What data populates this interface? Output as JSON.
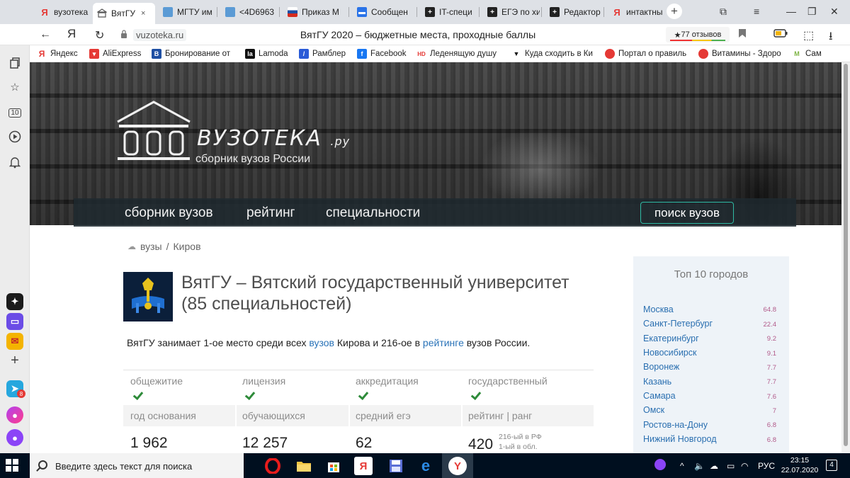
{
  "browser": {
    "tabs": [
      {
        "label": "вузотека",
        "icon": "yandex-icon"
      },
      {
        "label": "ВятГУ",
        "icon": "vuzoteka-favicon",
        "close": "×",
        "active": true
      },
      {
        "label": "МГТУ им",
        "icon": "site-favicon"
      },
      {
        "label": "<4D6963",
        "icon": "site-favicon"
      },
      {
        "label": "Приказ М",
        "icon": "flag-icon"
      },
      {
        "label": "Сообщен",
        "icon": "message-icon"
      },
      {
        "label": "IT-специ",
        "icon": "plus-icon"
      },
      {
        "label": "ЕГЭ по хи",
        "icon": "plus-icon"
      },
      {
        "label": "Редактор",
        "icon": "plus-icon"
      },
      {
        "label": "интактны",
        "icon": "yandex-icon"
      }
    ],
    "new_tab": "+",
    "url": "vuzoteka.ru",
    "page_title": "ВятГУ 2020 – бюджетные места, проходные баллы",
    "reviews": "77 отзывов",
    "reviews_star": "★",
    "bookmarks": [
      {
        "label": "Яндекс",
        "color": "#e53935",
        "glyph": "Я"
      },
      {
        "label": "AliExpress",
        "color": "#e53935",
        "glyph": "A"
      },
      {
        "label": "Бронирование от",
        "color": "#1e4fa3",
        "glyph": "B"
      },
      {
        "label": "Lamoda",
        "color": "#111111",
        "glyph": "la"
      },
      {
        "label": "Рамблер",
        "color": "#2a5bd7",
        "glyph": "/"
      },
      {
        "label": "Facebook",
        "color": "#1877f2",
        "glyph": "f"
      },
      {
        "label": "Леденящую душу",
        "color": "#e53935",
        "glyph": "HD"
      },
      {
        "label": "Куда сходить в Ки",
        "color": "#111111",
        "glyph": "▼"
      },
      {
        "label": "Портал о правиль",
        "color": "#e53935",
        "glyph": "●"
      },
      {
        "label": "Витамины - Здоро",
        "color": "#e53935",
        "glyph": "●"
      },
      {
        "label": "Сам",
        "color": "#7cb342",
        "glyph": "M"
      }
    ],
    "sidebar_counter": "10",
    "messenger_badge": "8"
  },
  "hero": {
    "site_name": "ВУЗОТЕКА",
    "site_suffix": ".ру",
    "slogan": "сборник вузов России"
  },
  "nav": {
    "items": [
      "сборник вузов",
      "рейтинг",
      "специальности"
    ],
    "search": "поиск вузов"
  },
  "breadcrumb": {
    "root": "вузы",
    "sep": "/",
    "city": "Киров"
  },
  "university": {
    "title": "ВятГУ – Вятский государственный университет (85 специальностей)",
    "desc_prefix": "ВятГУ занимает 1-ое место среди всех ",
    "desc_link1": "вузов",
    "desc_middle": " Кирова и 216-ое в ",
    "desc_link2": "рейтинге",
    "desc_suffix": " вузов России."
  },
  "stats": {
    "flags": [
      "общежитие",
      "лицензия",
      "аккредитация",
      "государственный"
    ],
    "headers": [
      "год основания",
      "обучающихся",
      "средний егэ",
      "рейтинг | ранг"
    ],
    "values": [
      "1 962",
      "12 257",
      "62",
      "420"
    ],
    "rank_rf": "216-ый в РФ",
    "rank_region": "1-ый в обл."
  },
  "top10": {
    "title": "Топ 10 городов",
    "cities": [
      {
        "name": "Москва",
        "score": "64.8"
      },
      {
        "name": "Санкт-Петербург",
        "score": "22.4"
      },
      {
        "name": "Екатеринбург",
        "score": "9.2"
      },
      {
        "name": "Новосибирск",
        "score": "9.1"
      },
      {
        "name": "Воронеж",
        "score": "7.7"
      },
      {
        "name": "Казань",
        "score": "7.7"
      },
      {
        "name": "Самара",
        "score": "7.6"
      },
      {
        "name": "Омск",
        "score": "7"
      },
      {
        "name": "Ростов-на-Дону",
        "score": "6.8"
      },
      {
        "name": "Нижний Новгород",
        "score": "6.8"
      }
    ]
  },
  "taskbar": {
    "search_placeholder": "Введите здесь текст для поиска",
    "lang": "РУС",
    "time": "23:15",
    "date": "22.07.2020",
    "notif_count": "4"
  },
  "colors": {
    "accent": "#2fb9a3",
    "link": "#2a73b8",
    "nav_bg": "#202a30",
    "check": "#2e8b3a",
    "score": "#b25a8a"
  }
}
